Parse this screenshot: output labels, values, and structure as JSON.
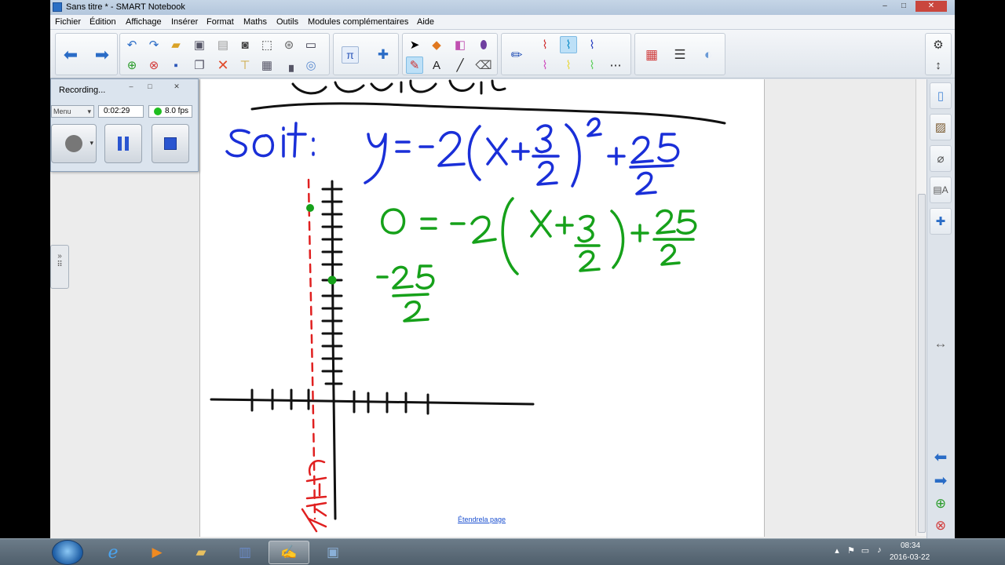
{
  "window": {
    "title": "Sans titre * - SMART Notebook",
    "controls": [
      "–",
      "□",
      "✕"
    ]
  },
  "menu": [
    "Fichier",
    "Édition",
    "Affichage",
    "Insérer",
    "Format",
    "Maths",
    "Outils",
    "Modules complémentaires",
    "Aide"
  ],
  "toolbar": {
    "nav_icons": [
      "back-arrow-icon",
      "forward-arrow-icon"
    ],
    "file_icons": [
      "undo-icon",
      "redo-icon",
      "open-icon",
      "screen-shade-icon",
      "paste-icon",
      "capture-icon",
      "fullscreen-icon",
      "table-icon",
      "display-icon",
      "add-page-icon",
      "delete-page-icon",
      "save-icon",
      "copy-icon",
      "delete-icon",
      "document-camera-icon",
      "table-insert-icon",
      "properties-icon",
      "gallery-icon"
    ],
    "math_icons": [
      "pi-icon",
      "addon-puzzle-icon"
    ],
    "tool_icons": [
      "select-pointer-icon",
      "shapes-icon",
      "eraser-icon",
      "fill-icon",
      "pen-icon",
      "text-icon",
      "line-icon",
      "creative-pen-icon"
    ],
    "pen_icons": [
      "pen-red-icon",
      "pen-cyan-icon",
      "pen-blue-icon",
      "pen-pink-icon",
      "pen-yellow-icon",
      "pen-green-icon",
      "pen-dashed-icon"
    ],
    "extra_icons": [
      "color-palette-icon",
      "line-style-icon",
      "transparency-icon"
    ]
  },
  "recorder": {
    "title": "Recording...",
    "menu_label": "Menu",
    "time": "0:02:29",
    "fps": "8.0 fps",
    "status_color": "#1fbe1f"
  },
  "page": {
    "extend_link": "Étendrela page",
    "ink_colors": {
      "black": "#111111",
      "blue": "#1a2fd8",
      "green": "#16a11a",
      "red": "#e02020"
    }
  },
  "sidebar_icons": [
    "settings-icon",
    "move-toolbar-icon",
    "page-sorter-icon",
    "gallery-icon",
    "attachments-icon",
    "properties-icon",
    "addons-icon",
    "resize-icon",
    "previous-page-icon",
    "next-page-icon",
    "add-page-icon",
    "delete-page-icon"
  ],
  "taskbar": {
    "apps": [
      "internet-explorer-icon",
      "media-player-icon",
      "file-explorer-icon",
      "city-app-icon",
      "smart-notebook-icon",
      "recorder-app-icon"
    ],
    "time": "08:34",
    "date": "2016-03-22"
  }
}
